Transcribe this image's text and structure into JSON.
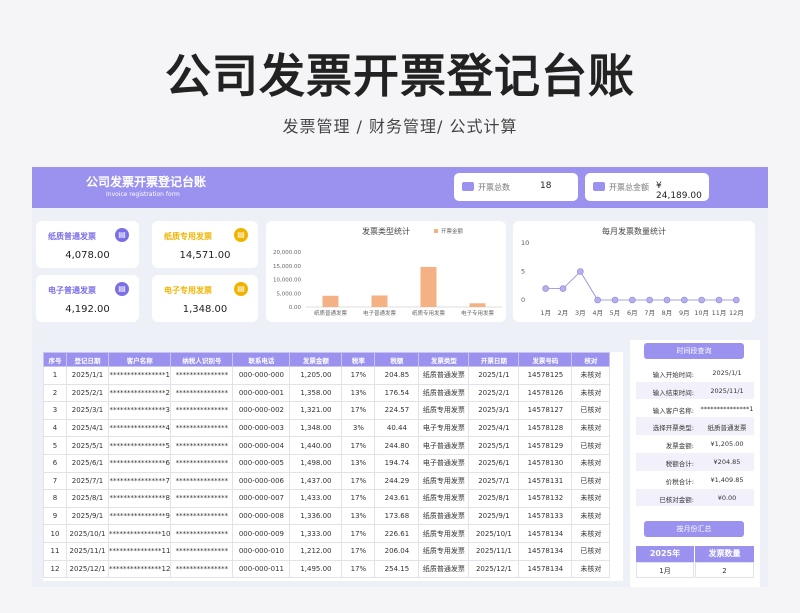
{
  "hero": {
    "title": "公司发票开票登记台账",
    "subtitle": "发票管理 / 财务管理/ 公式计算"
  },
  "banner": {
    "title": "公司发票开票登记台账",
    "subtitle": "Invoice registration form"
  },
  "stats": [
    {
      "label": "开票总数",
      "value": "18"
    },
    {
      "label": "开票总金额",
      "value": "¥ 24,189.00"
    }
  ],
  "kpis": [
    {
      "label": "纸质普通发票",
      "value": "4,078.00",
      "color": "#7b6fe6",
      "icon": "invoice-icon"
    },
    {
      "label": "纸质专用发票",
      "value": "14,571.00",
      "color": "#f0b400",
      "icon": "invoice-icon"
    },
    {
      "label": "电子普通发票",
      "value": "4,192.00",
      "color": "#7b6fe6",
      "icon": "invoice-icon"
    },
    {
      "label": "电子专用发票",
      "value": "1,348.00",
      "color": "#f0b400",
      "icon": "invoice-icon"
    }
  ],
  "chart_data": [
    {
      "type": "bar",
      "title": "发票类型统计",
      "categories": [
        "纸质普通发票",
        "电子普通发票",
        "纸质专用发票",
        "电子专用发票"
      ],
      "series": [
        {
          "name": "开票金额",
          "values": [
            4078,
            4192,
            14571,
            1348
          ],
          "color": "#f4b183"
        }
      ],
      "ylim": [
        0,
        20000
      ],
      "yticks": [
        "20,000.00",
        "15,000.00",
        "10,000.00",
        "5,000.00",
        "0.00"
      ],
      "legend": "top-right"
    },
    {
      "type": "line",
      "title": "每月发票数量统计",
      "categories": [
        "1月",
        "2月",
        "3月",
        "4月",
        "5月",
        "6月",
        "7月",
        "8月",
        "9月",
        "10月",
        "11月",
        "12月"
      ],
      "series": [
        {
          "values": [
            2,
            2,
            5,
            0,
            0,
            0,
            0,
            0,
            0,
            0,
            0,
            0
          ],
          "color": "#b4b0ea"
        }
      ],
      "ylim": [
        0,
        10
      ],
      "yticks": [
        "10",
        "5",
        "0"
      ]
    }
  ],
  "table": {
    "headers": [
      "序号",
      "登记日期",
      "客户名称",
      "纳税人识别号",
      "联系电话",
      "发票金额",
      "税率",
      "税额",
      "发票类型",
      "开票日期",
      "发票号码",
      "核对"
    ],
    "rows": [
      [
        "1",
        "2025/1/1",
        "****************1",
        "***************",
        "000-000-000",
        "1,205.00",
        "17%",
        "204.85",
        "纸质普通发票",
        "2025/1/1",
        "14578125",
        "未核对"
      ],
      [
        "2",
        "2025/2/1",
        "****************2",
        "***************",
        "000-000-001",
        "1,358.00",
        "13%",
        "176.54",
        "纸质普通发票",
        "2025/2/1",
        "14578126",
        "未核对"
      ],
      [
        "3",
        "2025/3/1",
        "****************3",
        "***************",
        "000-000-002",
        "1,321.00",
        "17%",
        "224.57",
        "纸质专用发票",
        "2025/3/1",
        "14578127",
        "已核对"
      ],
      [
        "4",
        "2025/4/1",
        "****************4",
        "***************",
        "000-000-003",
        "1,348.00",
        "3%",
        "40.44",
        "电子专用发票",
        "2025/4/1",
        "14578128",
        "未核对"
      ],
      [
        "5",
        "2025/5/1",
        "****************5",
        "***************",
        "000-000-004",
        "1,440.00",
        "17%",
        "244.80",
        "电子普通发票",
        "2025/5/1",
        "14578129",
        "已核对"
      ],
      [
        "6",
        "2025/6/1",
        "****************6",
        "***************",
        "000-000-005",
        "1,498.00",
        "13%",
        "194.74",
        "电子普通发票",
        "2025/6/1",
        "14578130",
        "未核对"
      ],
      [
        "7",
        "2025/7/1",
        "****************7",
        "***************",
        "000-000-006",
        "1,437.00",
        "17%",
        "244.29",
        "纸质专用发票",
        "2025/7/1",
        "14578131",
        "已核对"
      ],
      [
        "8",
        "2025/8/1",
        "****************8",
        "***************",
        "000-000-007",
        "1,433.00",
        "17%",
        "243.61",
        "纸质专用发票",
        "2025/8/1",
        "14578132",
        "未核对"
      ],
      [
        "9",
        "2025/9/1",
        "****************9",
        "***************",
        "000-000-008",
        "1,336.00",
        "13%",
        "173.68",
        "纸质普通发票",
        "2025/9/1",
        "14578133",
        "未核对"
      ],
      [
        "10",
        "2025/10/1",
        "***************10",
        "***************",
        "000-000-009",
        "1,333.00",
        "17%",
        "226.61",
        "纸质专用发票",
        "2025/10/1",
        "14578134",
        "未核对"
      ],
      [
        "11",
        "2025/11/1",
        "***************11",
        "***************",
        "000-000-010",
        "1,212.00",
        "17%",
        "206.04",
        "纸质专用发票",
        "2025/11/1",
        "14578134",
        "已核对"
      ],
      [
        "12",
        "2025/12/1",
        "***************12",
        "***************",
        "000-000-011",
        "1,495.00",
        "17%",
        "254.15",
        "纸质普通发票",
        "2025/12/1",
        "14578134",
        "未核对"
      ]
    ]
  },
  "query": {
    "button": "时间段查询",
    "fields": [
      {
        "label": "输入开始时间:",
        "value": "2025/1/1"
      },
      {
        "label": "输入结束时间:",
        "value": "2025/11/1"
      },
      {
        "label": "输入客户名称:",
        "value": "***************1"
      },
      {
        "label": "选择开票类型:",
        "value": "纸质普通发票"
      },
      {
        "label": "发票金额:",
        "value": "¥1,205.00"
      },
      {
        "label": "税额合计:",
        "value": "¥204.85"
      },
      {
        "label": "价税合计:",
        "value": "¥1,409.85"
      },
      {
        "label": "已核对金额:",
        "value": "¥0.00"
      }
    ]
  },
  "monthly": {
    "button": "按月份汇总",
    "headers": [
      "2025年",
      "发票数量"
    ],
    "row": [
      "1月",
      "2"
    ]
  }
}
